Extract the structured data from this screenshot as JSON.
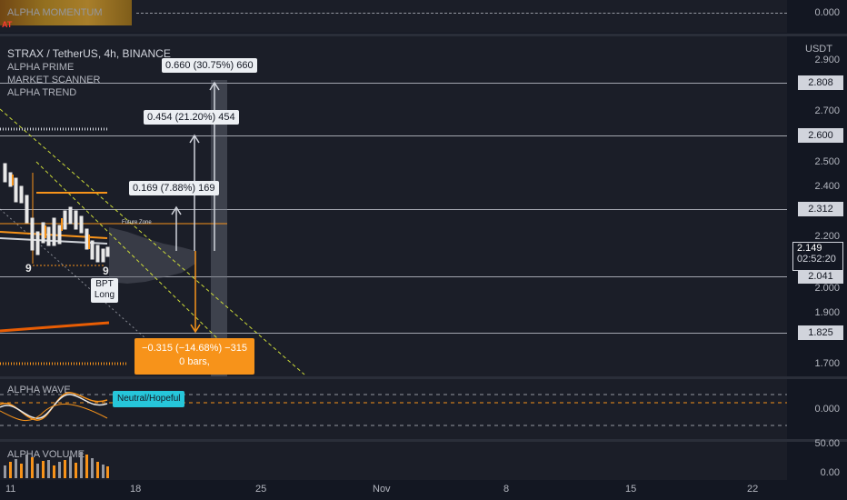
{
  "momentum_pane": {
    "title": "ALPHA MOMENTUM",
    "badge": "AT",
    "axis_label": "0.000"
  },
  "main_pane": {
    "symbol_title": "STRAX / TetherUS, 4h, BINANCE",
    "indicators": [
      "ALPHA PRIME",
      "MARKET SCANNER",
      "ALPHA TREND"
    ],
    "currency": "USDT",
    "ticks": [
      "2.900",
      "2.700",
      "2.500",
      "2.400",
      "2.200",
      "2.000",
      "1.900",
      "1.700"
    ],
    "levels": [
      "2.808",
      "2.600",
      "2.312",
      "2.041",
      "1.825"
    ],
    "current_price": "2.149",
    "countdown": "02:52:20",
    "measure_boxes": [
      "0.660 (30.75%) 660",
      "0.454 (21.20%) 454",
      "0.169 (7.88%) 169"
    ],
    "down_box": {
      "line1": "−0.315 (−14.68%) −315",
      "line2": "0 bars,"
    },
    "bpt_label": [
      "BPT",
      "Long"
    ],
    "count_labels": [
      "9",
      "9"
    ],
    "future_label": "Future Zone"
  },
  "wave_pane": {
    "title": "ALPHA WAVE",
    "badge": "Neutral/Hopeful",
    "axis_label": "0.000"
  },
  "volume_pane": {
    "title": "ALPHA VOLUME",
    "ticks": [
      "50.00",
      "0.00"
    ]
  },
  "time_axis": [
    "11",
    "18",
    "25",
    "Nov",
    "8",
    "15",
    "22"
  ],
  "colors": {
    "background": "#131722",
    "pane": "#1b1e28",
    "orange": "#f7931a",
    "yellow_green": "#cddc39",
    "cyan": "#26c6da",
    "candle": "#e8e8e8"
  }
}
